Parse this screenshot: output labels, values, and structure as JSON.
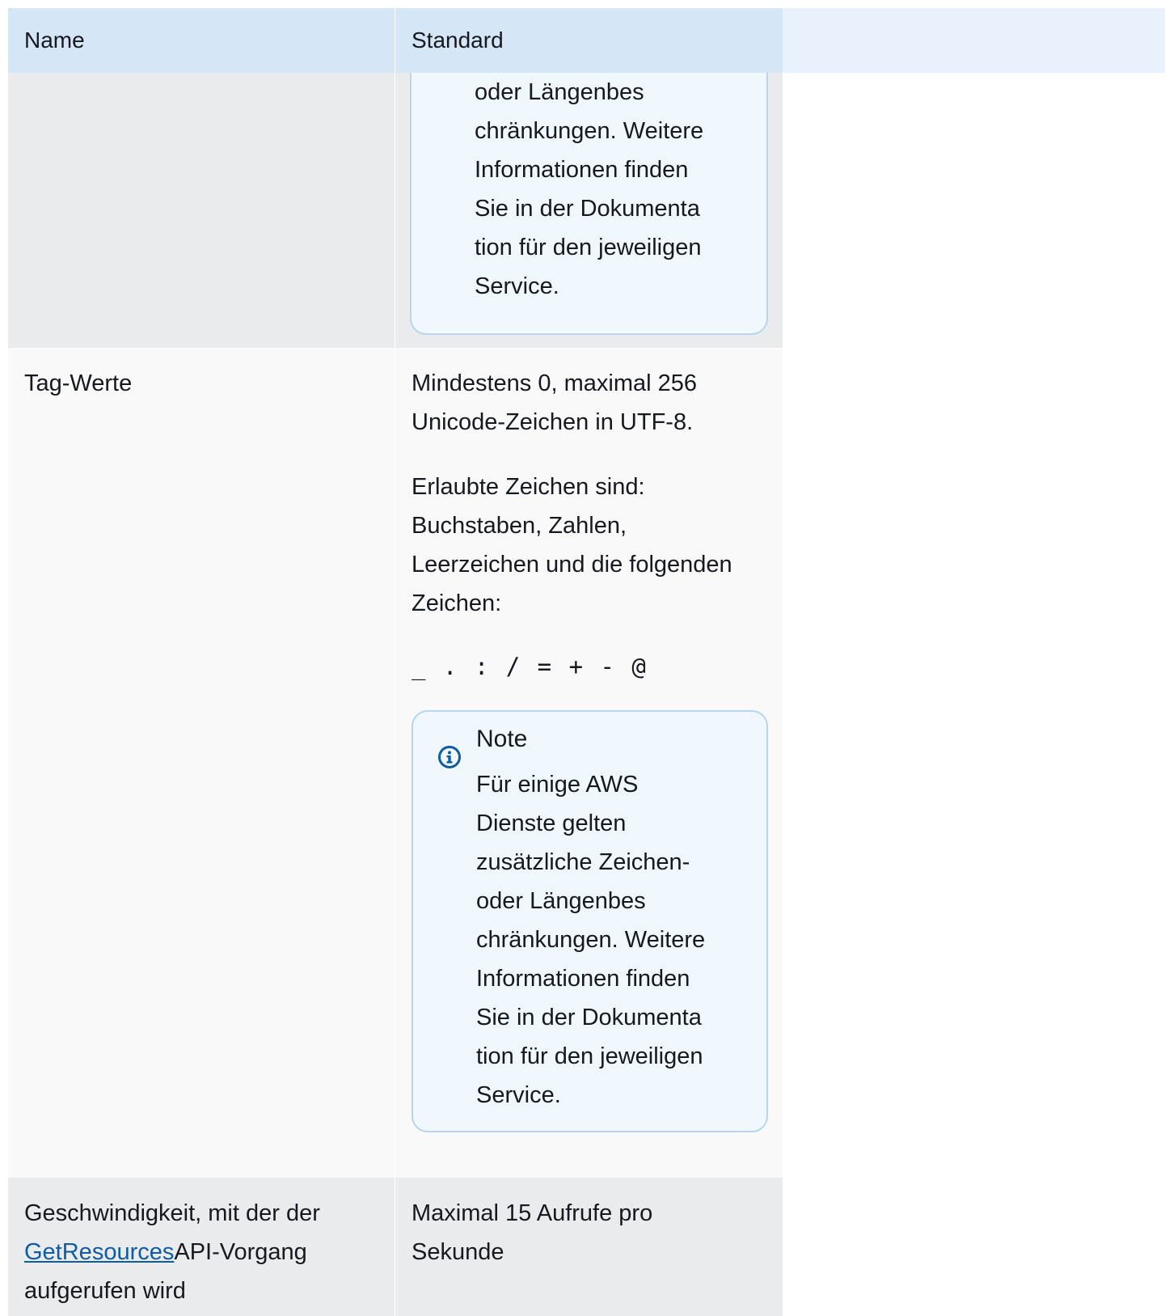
{
  "table": {
    "headers": {
      "name": "Name",
      "standard": "Standard"
    },
    "rows": [
      {
        "note_text_lines": [
          "oder Längenbes",
          "chränkungen. Weitere",
          "Informationen finden",
          "Sie in der Dokumenta",
          "tion für den jeweiligen",
          "Service."
        ]
      },
      {
        "name": "Tag-Werte",
        "para1_lines": [
          "Mindestens 0, maximal 256",
          "Unicode-Zeichen in UTF-8."
        ],
        "para2_lines": [
          "Erlaubte Zeichen sind:",
          "Buchstaben, Zahlen,",
          "Leerzeichen und die folgenden",
          "Zeichen:"
        ],
        "allowed_chars": "_ . : / = + - @",
        "note": {
          "title": "Note",
          "icon": "info-icon",
          "text_lines": [
            "Für einige AWS",
            "Dienste gelten",
            "zusätzliche Zeichen-",
            "oder Längenbes",
            "chränkungen. Weitere",
            "Informationen finden",
            "Sie in der Dokumenta",
            "tion für den jeweiligen",
            "Service."
          ]
        }
      },
      {
        "name_prefix": "Geschwindigkeit, mit der der",
        "name_link": "GetResources",
        "name_suffix_line1": "API-Vorgang",
        "name_suffix_line2": "aufgerufen wird",
        "standard_lines": [
          "Maximal 15 Aufrufe pro",
          "Sekunde"
        ]
      }
    ]
  },
  "colors": {
    "header_bg": "#d5e6f7",
    "row_grey": "#eaebec",
    "row_light": "#f9f9f9",
    "note_bg": "#f0f7fd",
    "note_border": "#b7d5f0",
    "link": "#0f5ba6",
    "info_icon": "#0f5ba6"
  }
}
